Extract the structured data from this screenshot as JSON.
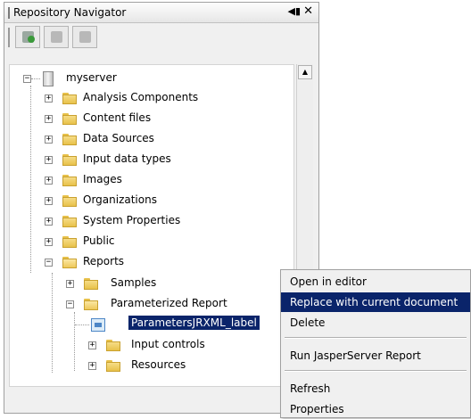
{
  "panel": {
    "title": "Repository Navigator",
    "pin_glyph": "◀▮",
    "close_glyph": "✕"
  },
  "toolbar": {
    "buttons": [
      {
        "icon": "add-server-icon"
      },
      {
        "icon": "edit-server-icon"
      },
      {
        "icon": "delete-server-icon"
      }
    ]
  },
  "tree": {
    "root": "myserver",
    "items": [
      "Analysis Components",
      "Content files",
      "Data Sources",
      "Input data types",
      "Images",
      "Organizations",
      "System Properties",
      "Public",
      "Reports"
    ],
    "reports_children": [
      "Samples",
      "Parameterized Report"
    ],
    "parameterized_children": [
      "ParametersJRXML_label",
      "Input controls",
      "Resources"
    ]
  },
  "context_menu": {
    "items": [
      "Open in editor",
      "Replace with current document",
      "Delete",
      "Run JasperServer Report",
      "Refresh",
      "Properties"
    ],
    "highlighted": "Replace with current document",
    "highlight_color": "#0a246a"
  },
  "glyphs": {
    "plus": "+",
    "minus": "−",
    "scroll_up": "▲"
  }
}
